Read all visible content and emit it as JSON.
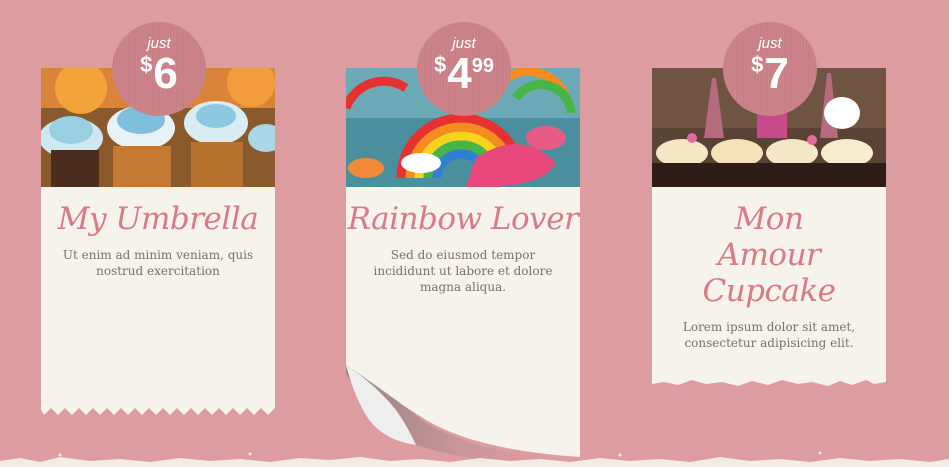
{
  "cards": [
    {
      "title": "My Umbrella",
      "description": "Ut enim ad minim veniam, quis nostrud exercitation",
      "price_prefix": "just",
      "currency": "$",
      "price_whole": "6",
      "price_cents": ""
    },
    {
      "title": "Rainbow Lover",
      "description": "Sed do eiusmod tempor incididunt ut labore et dolore magna aliqua.",
      "price_prefix": "just",
      "currency": "$",
      "price_whole": "4",
      "price_cents": "99"
    },
    {
      "title": "Mon Amour Cupcake",
      "description": "Lorem ipsum dolor sit amet, consectetur adipisicing elit.",
      "price_prefix": "just",
      "currency": "$",
      "price_whole": "7",
      "price_cents": ""
    }
  ],
  "colors": {
    "background": "#dd9ca0",
    "card": "#f6f2ec",
    "title": "#d97a86",
    "price_badge": "#c97f86"
  },
  "icons": [
    "umbrella-cupcakes-image",
    "rainbow-cupcakes-image",
    "eiffel-cupcakes-image"
  ]
}
